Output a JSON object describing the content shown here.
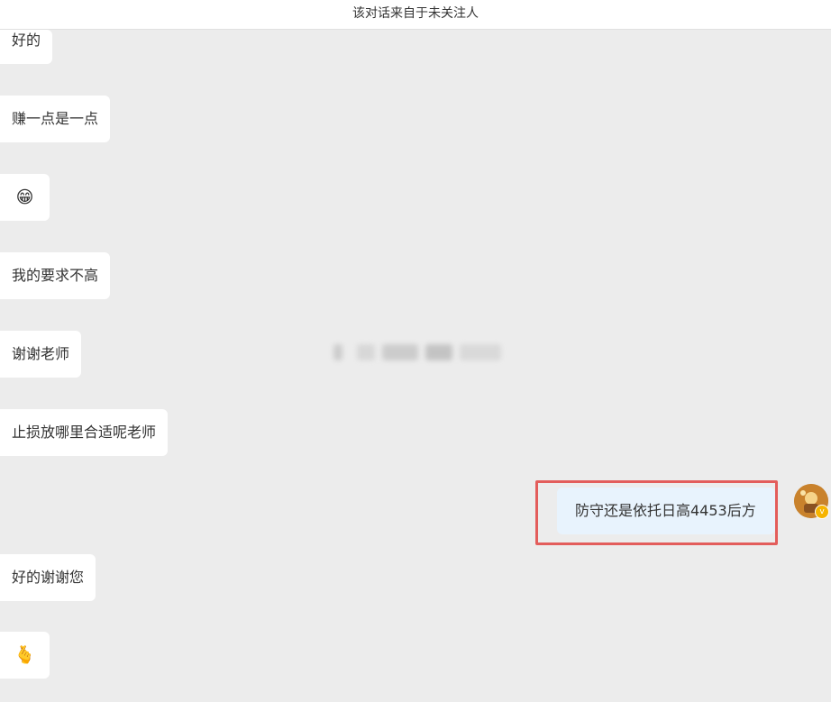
{
  "header": {
    "notice": "该对话来自于未关注人"
  },
  "messages": [
    {
      "text": "好的"
    },
    {
      "text": "赚一点是一点"
    },
    {
      "emoji": "😁"
    },
    {
      "text": "我的要求不高"
    },
    {
      "text": "谢谢老师"
    },
    {
      "text": "止损放哪里合适呢老师"
    },
    {
      "text": "防守还是依托日高4453后方",
      "outgoing": true
    },
    {
      "text": "好的谢谢您"
    },
    {
      "emoji": "🫰"
    }
  ],
  "avatar": {
    "badge": "v",
    "badge_color": "#f6b400"
  },
  "colors": {
    "background": "#ececec",
    "incoming_bubble": "#ffffff",
    "outgoing_bubble": "#e8f3fd",
    "highlight_border": "#e35d5b"
  }
}
